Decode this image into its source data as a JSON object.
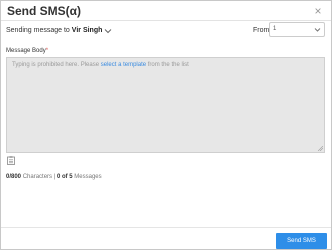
{
  "dialog": {
    "title": "Send SMS(α)",
    "close_symbol": "×"
  },
  "recipient": {
    "prefix": "Sending message to",
    "name": "Vir Singh",
    "chevron_icon": "chevron-down-icon"
  },
  "from": {
    "label": "From",
    "value": "1"
  },
  "message_body": {
    "label": "Message Body",
    "required_mark": "*",
    "placeholder_before": "Typing is prohibited here. Please",
    "placeholder_link": "select a template",
    "placeholder_after": "from the the list",
    "template_icon": "clipboard-icon"
  },
  "counts": {
    "characters": "0/800",
    "characters_label": "Characters",
    "separator": "|",
    "messages": "0 of 5",
    "messages_label": "Messages"
  },
  "footer": {
    "send_label": "Send SMS"
  },
  "colors": {
    "accent": "#2e8ee8",
    "link": "#3a8be0",
    "required": "#d9534f",
    "textarea_bg": "#e7e7e7"
  }
}
